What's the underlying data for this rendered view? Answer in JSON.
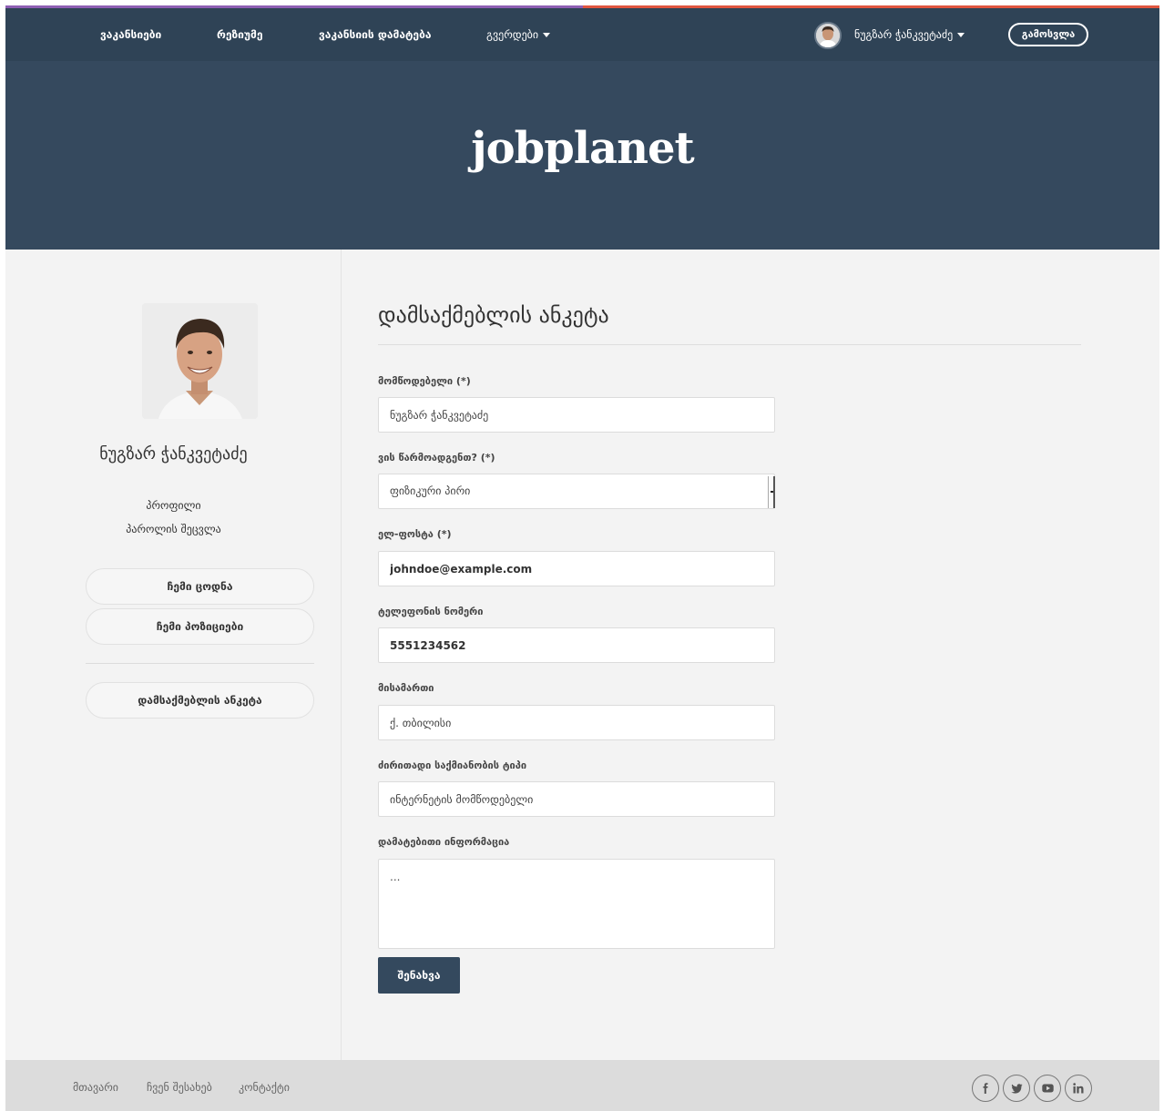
{
  "nav": {
    "items": [
      {
        "label": "ვაკანსიები"
      },
      {
        "label": "რეზიუმე"
      },
      {
        "label": "ვაკანსიის დამატება"
      },
      {
        "label": "გვერდები"
      }
    ],
    "user_name": "ნუგზარ ჭანკვეტაძე",
    "logout_label": "გამოსვლა"
  },
  "hero": {
    "logo": "jobplanet"
  },
  "sidebar": {
    "name": "ნუგზარ ჭანკვეტაძე",
    "links": [
      {
        "label": "პროფილი"
      },
      {
        "label": "პაროლის შეცვლა"
      }
    ],
    "pills": [
      {
        "label": "ჩემი ცოდნა"
      },
      {
        "label": "ჩემი პოზიციები"
      },
      {
        "label": "დამსაქმებლის ანკეტა"
      }
    ]
  },
  "form": {
    "title": "დამსაქმებლის ანკეტა",
    "fields": [
      {
        "label": "მომწოდებელი (*)",
        "value": "ნუგზარ ჭანკვეტაძე"
      },
      {
        "label": "ვის წარმოადგენთ? (*)",
        "value": "ფიზიკური პირი"
      },
      {
        "label": "ელ-ფოსტა (*)",
        "value": "johndoe@example.com"
      },
      {
        "label": "ტელეფონის ნომერი",
        "value": "5551234562"
      },
      {
        "label": "მისამართი",
        "value": "ქ. თბილისი"
      },
      {
        "label": "ძირითადი საქმიანობის ტიპი",
        "value": "ინტერნეტის მომწოდებელი"
      },
      {
        "label": "დამატებითი ინფორმაცია",
        "value": "..."
      }
    ],
    "save_label": "შენახვა"
  },
  "footer": {
    "links": [
      {
        "label": "მთავარი"
      },
      {
        "label": "ჩვენ შესახებ"
      },
      {
        "label": "კონტაქტი"
      }
    ],
    "social": [
      "facebook-icon",
      "twitter-icon",
      "youtube-icon",
      "linkedin-icon"
    ]
  },
  "colors": {
    "nav_bg": "#2f4356",
    "hero_bg": "#35495e",
    "accent_purple": "#8e5fb3",
    "accent_red": "#e0563f",
    "button_bg": "#34495e",
    "page_bg": "#f3f3f3",
    "footer_bg": "#dcdcdc"
  }
}
